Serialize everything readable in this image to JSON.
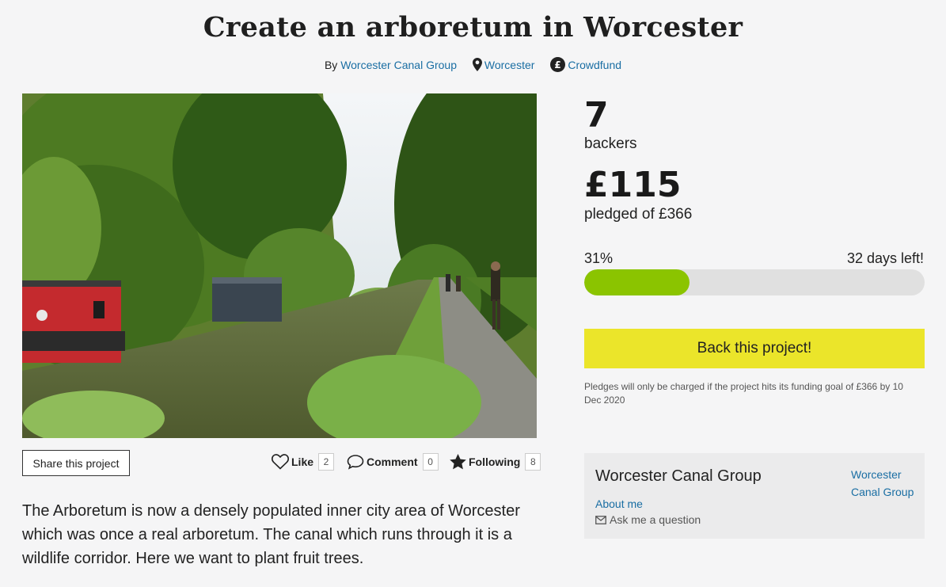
{
  "page": {
    "title": "Create an arboretum in Worcester",
    "by_prefix": "By",
    "owner_link": "Worcester Canal Group",
    "location": "Worcester",
    "funding_type": "Crowdfund"
  },
  "stats": {
    "backers_count": "7",
    "backers_label": "backers",
    "pledged_amount": "£115",
    "pledged_label": "pledged of £366",
    "percent_label": "31%",
    "percent_value": 0.31,
    "days_left": "32 days left!"
  },
  "cta": {
    "back_label": "Back this project!",
    "note": "Pledges will only be charged if the project hits its funding goal of £366 by 10 Dec 2020"
  },
  "social": {
    "share_label": "Share this project",
    "like_label": "Like",
    "like_count": "2",
    "comment_label": "Comment",
    "comment_count": "0",
    "following_label": "Following",
    "following_count": "8"
  },
  "description": "The Arboretum is now a densely populated inner city area of Worcester which was once a real arboretum. The canal which runs through it is a wildlife corridor. Here we want to plant fruit trees.",
  "owner_box": {
    "name": "Worcester Canal Group",
    "about": "About me",
    "ask": "Ask me a question",
    "side_link": "Worcester Canal Group"
  },
  "colors": {
    "progress": "#8bc400",
    "cta": "#ebe52a",
    "link": "#1a6ea3"
  }
}
